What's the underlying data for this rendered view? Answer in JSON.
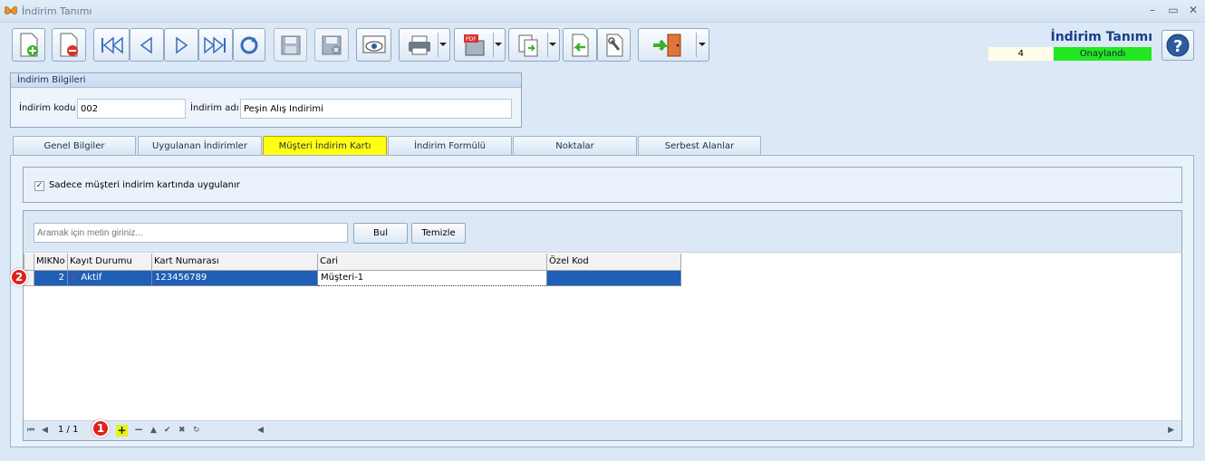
{
  "window": {
    "title": "İndirim Tanımı"
  },
  "header": {
    "title": "İndirim Tanımı",
    "record_number": "4",
    "status": "Onaylandı",
    "status_color": "#22e822"
  },
  "toolbar": {
    "buttons": [
      "new-document-icon",
      "delete-document-icon",
      "first-record-icon",
      "previous-record-icon",
      "next-record-icon",
      "last-record-icon",
      "refresh-icon",
      "save-icon",
      "save-close-icon",
      "preview-icon",
      "print-icon",
      "pdf-icon",
      "export-icon",
      "back-icon",
      "tools-icon",
      "exit-icon",
      "help-icon"
    ]
  },
  "discount_info": {
    "title": "İndirim Bilgileri",
    "code_label": "İndirim kodu",
    "code_value": "002",
    "name_label": "İndirim adı",
    "name_value": "Peşin Alış İndirimi"
  },
  "tabs": [
    {
      "label": "Genel Bilgiler"
    },
    {
      "label": "Uygulanan İndirimler"
    },
    {
      "label": "Müşteri İndirim Kartı"
    },
    {
      "label": "İndirim Formülü"
    },
    {
      "label": "Noktalar"
    },
    {
      "label": "Serbest Alanlar"
    }
  ],
  "customer_card": {
    "checkbox_label": "Sadece müşteri indirim kartında uygulanır",
    "checkbox_checked": true,
    "search_placeholder": "Aramak için metin giriniz...",
    "find_button": "Bul",
    "clear_button": "Temizle",
    "columns": [
      "MIKNo",
      "Kayıt Durumu",
      "Kart Numarası",
      "Cari",
      "Özel Kod"
    ],
    "rows": [
      {
        "mikno": "2",
        "status": "Aktif",
        "card_number": "123456789",
        "cari": "Müşteri-1",
        "special_code": ""
      }
    ],
    "pager_text": "1 / 1"
  },
  "markers": [
    "1",
    "2"
  ]
}
